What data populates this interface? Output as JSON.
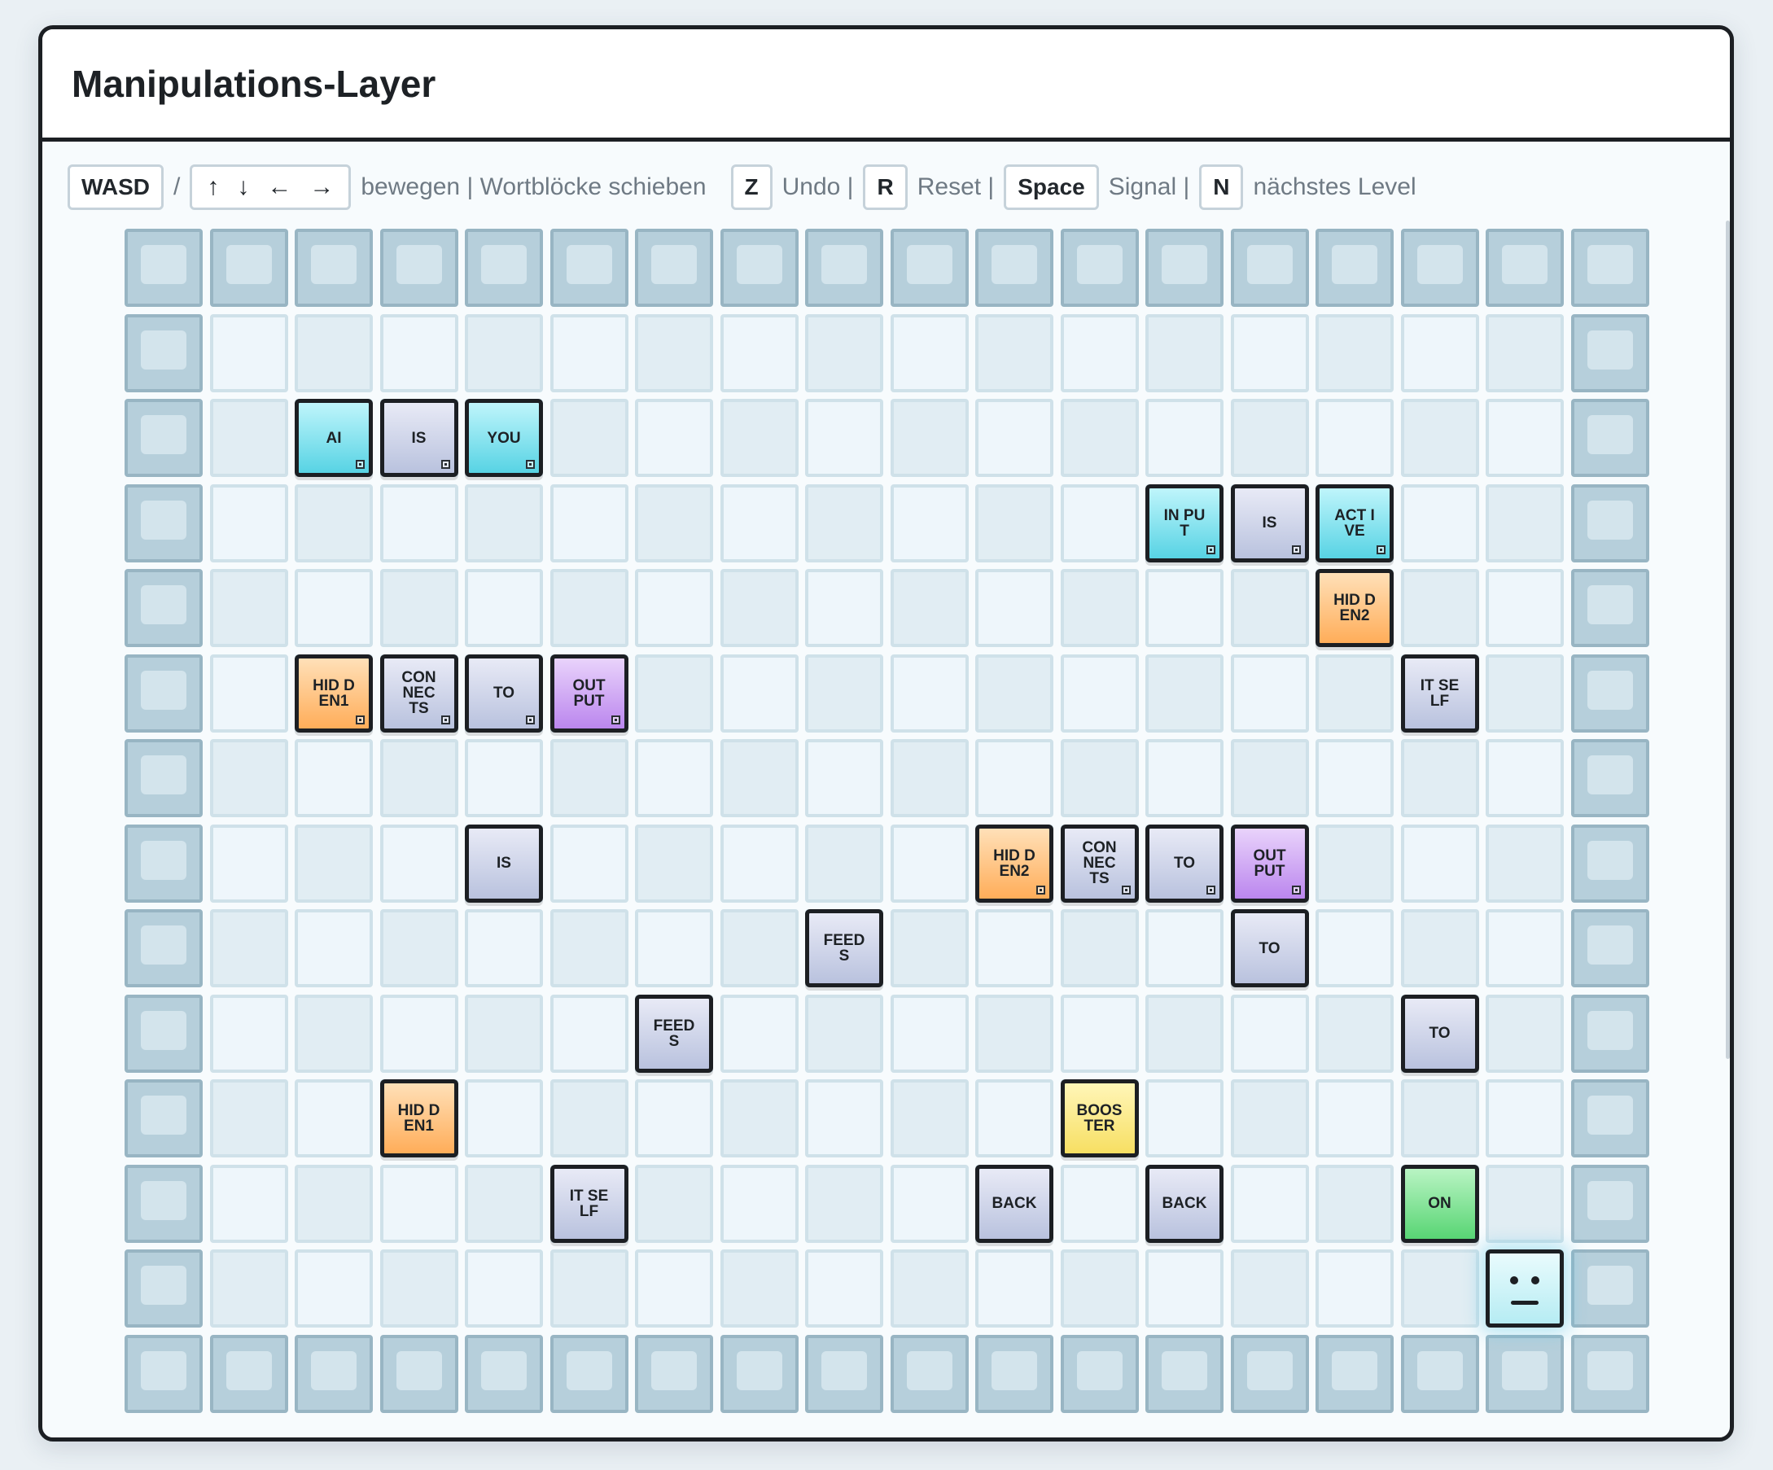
{
  "title": "Manipulations-Layer",
  "controls": {
    "wasd": "WASD",
    "slash": "/",
    "arrow_up": "↑",
    "arrow_down": "↓",
    "arrow_left": "←",
    "arrow_right": "→",
    "move_hint": "bewegen | Wortblöcke schieben",
    "undo_key": "Z",
    "undo_label": "Undo |",
    "reset_key": "R",
    "reset_label": "Reset |",
    "signal_key": "Space",
    "signal_label": "Signal |",
    "next_key": "N",
    "next_label": "nächstes Level"
  },
  "board": {
    "cols": 18,
    "rows": 14,
    "blocks": [
      {
        "label": "AI",
        "kind": "noun-ai",
        "col": 2,
        "row": 2,
        "corner": true
      },
      {
        "label": "IS",
        "kind": "verb",
        "col": 3,
        "row": 2,
        "corner": true
      },
      {
        "label": "YOU",
        "kind": "noun-ai",
        "col": 4,
        "row": 2,
        "corner": true
      },
      {
        "label": "IN PUT",
        "kind": "noun-ai",
        "col": 12,
        "row": 3,
        "corner": true
      },
      {
        "label": "IS",
        "kind": "verb",
        "col": 13,
        "row": 3,
        "corner": true
      },
      {
        "label": "ACT IVE",
        "kind": "noun-ai",
        "col": 14,
        "row": 3,
        "corner": true
      },
      {
        "label": "HID DEN2",
        "kind": "hidden",
        "col": 14,
        "row": 4,
        "corner": false
      },
      {
        "label": "HID DEN1",
        "kind": "hidden",
        "col": 2,
        "row": 5,
        "corner": true
      },
      {
        "label": "CON NEC TS",
        "kind": "verb",
        "col": 3,
        "row": 5,
        "corner": true
      },
      {
        "label": "TO",
        "kind": "verb",
        "col": 4,
        "row": 5,
        "corner": true
      },
      {
        "label": "OUT PUT",
        "kind": "output",
        "col": 5,
        "row": 5,
        "corner": true
      },
      {
        "label": "IT SELF",
        "kind": "verb",
        "col": 15,
        "row": 5,
        "corner": false
      },
      {
        "label": "IS",
        "kind": "verb",
        "col": 4,
        "row": 7,
        "corner": false
      },
      {
        "label": "HID DEN2",
        "kind": "hidden",
        "col": 10,
        "row": 7,
        "corner": true
      },
      {
        "label": "CON NEC TS",
        "kind": "verb",
        "col": 11,
        "row": 7,
        "corner": true
      },
      {
        "label": "TO",
        "kind": "verb",
        "col": 12,
        "row": 7,
        "corner": true
      },
      {
        "label": "OUT PUT",
        "kind": "output",
        "col": 13,
        "row": 7,
        "corner": true
      },
      {
        "label": "FEEDS",
        "kind": "verb",
        "col": 8,
        "row": 8,
        "corner": false
      },
      {
        "label": "TO",
        "kind": "verb",
        "col": 13,
        "row": 8,
        "corner": false
      },
      {
        "label": "FEEDS",
        "kind": "verb",
        "col": 6,
        "row": 9,
        "corner": false
      },
      {
        "label": "TO",
        "kind": "verb",
        "col": 15,
        "row": 9,
        "corner": false
      },
      {
        "label": "HID DEN1",
        "kind": "hidden",
        "col": 3,
        "row": 10,
        "corner": false
      },
      {
        "label": "BOOS TER",
        "kind": "booster",
        "col": 11,
        "row": 10,
        "corner": false
      },
      {
        "label": "IT SELF",
        "kind": "verb",
        "col": 5,
        "row": 11,
        "corner": false
      },
      {
        "label": "BACK",
        "kind": "verb",
        "col": 10,
        "row": 11,
        "corner": false
      },
      {
        "label": "BACK",
        "kind": "verb",
        "col": 12,
        "row": 11,
        "corner": false
      },
      {
        "label": "ON",
        "kind": "on",
        "col": 15,
        "row": 11,
        "corner": false
      }
    ],
    "player": {
      "col": 16,
      "row": 12
    }
  }
}
